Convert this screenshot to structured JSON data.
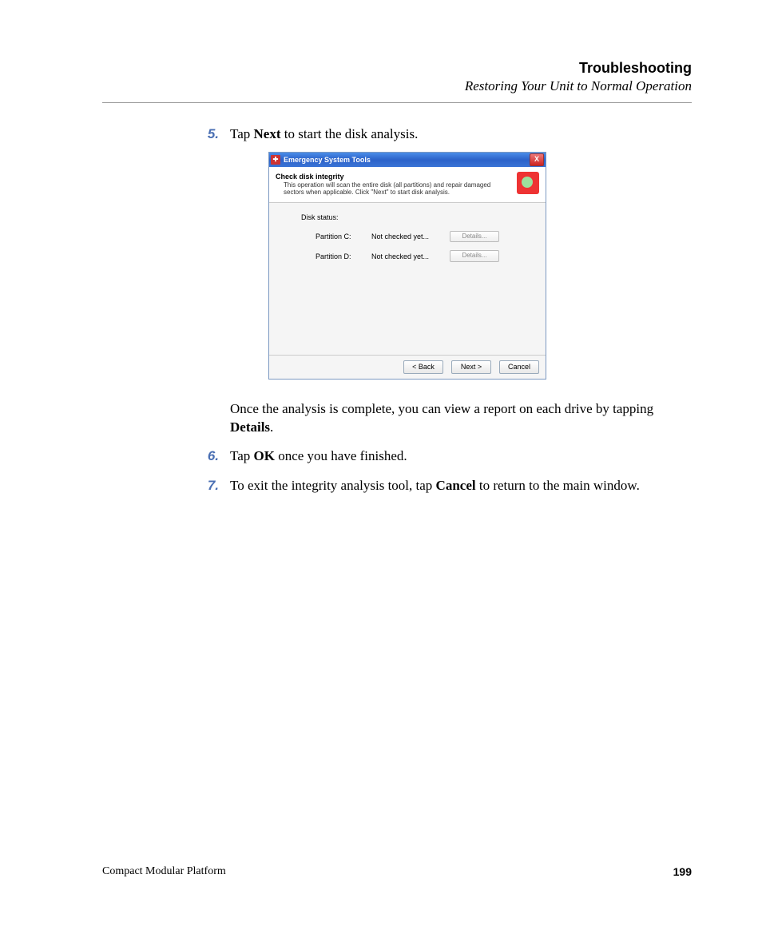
{
  "header": {
    "chapter": "Troubleshooting",
    "section": "Restoring Your Unit to Normal Operation"
  },
  "steps": {
    "s5_num": "5.",
    "s5_prefix": "Tap ",
    "s5_bold": "Next",
    "s5_suffix": " to start the disk analysis.",
    "followup_prefix": "Once the analysis is complete, you can view a report on each drive by tapping ",
    "followup_bold": "Details",
    "followup_suffix": ".",
    "s6_num": "6.",
    "s6_prefix": "Tap ",
    "s6_bold": "OK",
    "s6_suffix": " once you have finished.",
    "s7_num": "7.",
    "s7_prefix": "To exit the integrity analysis tool, tap ",
    "s7_bold": "Cancel",
    "s7_suffix": " to return to the main window."
  },
  "dialog": {
    "title": "Emergency System Tools",
    "close": "X",
    "banner_title": "Check disk integrity",
    "banner_desc": "This operation will scan the entire disk (all partitions) and repair damaged sectors when applicable. Click \"Next\" to start disk analysis.",
    "disk_status": "Disk status:",
    "rows": [
      {
        "name": "Partition C:",
        "status": "Not checked yet...",
        "details": "Details..."
      },
      {
        "name": "Partition D:",
        "status": "Not checked yet...",
        "details": "Details..."
      }
    ],
    "back": "< Back",
    "next": "Next >",
    "cancel": "Cancel"
  },
  "footer": {
    "left": "Compact Modular Platform",
    "right": "199"
  }
}
